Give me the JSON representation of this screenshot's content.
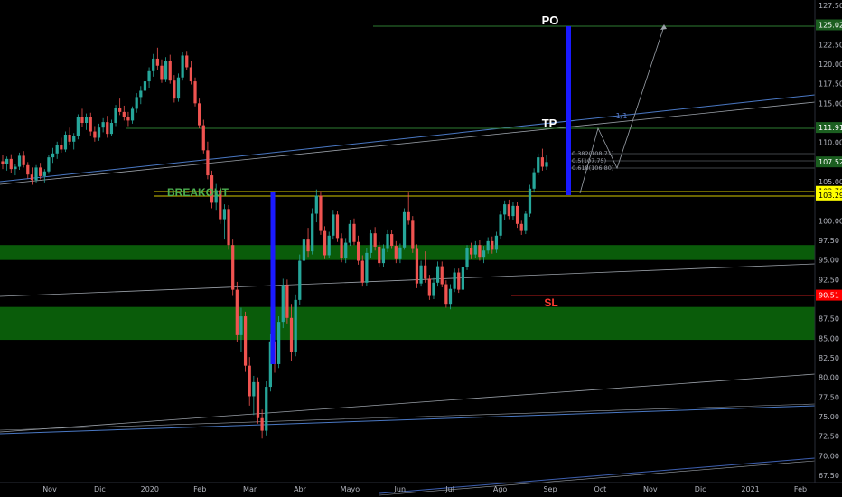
{
  "chart_data": {
    "type": "candlestick",
    "y_scale": "linear",
    "ylim": [
      67.5,
      127.5
    ],
    "y_ticks": [
      "127.50",
      "122.50",
      "120.00",
      "117.50",
      "115.00",
      "110.00",
      "105.00",
      "100.00",
      "97.50",
      "95.00",
      "92.50",
      "87.50",
      "85.00",
      "82.50",
      "80.00",
      "77.50",
      "75.00",
      "72.50",
      "70.00",
      "67.50"
    ],
    "x_ticks": [
      "Nov",
      "Dic",
      "2020",
      "Feb",
      "Mar",
      "Abr",
      "Mayo",
      "Jun",
      "Jul",
      "Ago",
      "Sep",
      "Oct",
      "Nov",
      "Dic",
      "2021",
      "Feb"
    ],
    "price_badges": [
      {
        "label": "125.02",
        "value": 125.02,
        "bg": "#1b5e20",
        "fg": "#ffffff"
      },
      {
        "label": "111.91",
        "value": 111.91,
        "bg": "#1b5e20",
        "fg": "#ffffff"
      },
      {
        "label": "107.52",
        "value": 107.52,
        "bg": "#1b5e20",
        "fg": "#ffffff"
      },
      {
        "label": "103.76",
        "value": 103.76,
        "bg": "#ffff00",
        "fg": "#000000"
      },
      {
        "label": "103.29",
        "value": 103.29,
        "bg": "#ffff00",
        "fg": "#000000"
      },
      {
        "label": "90.51",
        "value": 90.51,
        "bg": "#ff0000",
        "fg": "#ffffff"
      }
    ],
    "annotations": [
      {
        "text": "PO",
        "value": 125.5,
        "color": "#ffffff"
      },
      {
        "text": "TP",
        "value": 112.2,
        "color": "#ffffff"
      },
      {
        "text": "BREAKOUT",
        "value": 103.8,
        "color": "#4caf50"
      },
      {
        "text": "SL",
        "value": 89.8,
        "color": "#ff3b30"
      },
      {
        "text": "1/1",
        "value": 113.5,
        "color": "#5b7fd1"
      }
    ],
    "fib_levels": [
      {
        "label": "0.382(108.71)",
        "value": 108.71
      },
      {
        "label": "0.5(107.75)",
        "value": 107.75
      },
      {
        "label": "0.618(106.80)",
        "value": 106.8
      }
    ],
    "zones": [
      {
        "from": 95.0,
        "to": 96.9,
        "color": "#0a5c0a"
      },
      {
        "from": 84.8,
        "to": 89.0,
        "color": "#0a5c0a"
      }
    ],
    "candles": [
      {
        "o": 107.6,
        "h": 108.4,
        "l": 106.6,
        "c": 107.2
      },
      {
        "o": 107.2,
        "h": 108.2,
        "l": 106.4,
        "c": 107.9
      },
      {
        "o": 107.9,
        "h": 108.5,
        "l": 106.1,
        "c": 106.6
      },
      {
        "o": 106.6,
        "h": 107.3,
        "l": 105.8,
        "c": 106.9
      },
      {
        "o": 106.9,
        "h": 108.7,
        "l": 106.5,
        "c": 108.3
      },
      {
        "o": 108.3,
        "h": 108.9,
        "l": 106.8,
        "c": 107.1
      },
      {
        "o": 107.1,
        "h": 107.5,
        "l": 105.4,
        "c": 105.9
      },
      {
        "o": 105.9,
        "h": 106.8,
        "l": 104.6,
        "c": 105.2
      },
      {
        "o": 105.2,
        "h": 107.1,
        "l": 104.9,
        "c": 106.8
      },
      {
        "o": 106.8,
        "h": 107.4,
        "l": 105.3,
        "c": 105.7
      },
      {
        "o": 105.7,
        "h": 106.6,
        "l": 104.9,
        "c": 106.3
      },
      {
        "o": 106.3,
        "h": 108.4,
        "l": 106.0,
        "c": 108.1
      },
      {
        "o": 108.1,
        "h": 109.3,
        "l": 107.4,
        "c": 108.6
      },
      {
        "o": 108.6,
        "h": 110.1,
        "l": 107.9,
        "c": 109.7
      },
      {
        "o": 109.7,
        "h": 110.6,
        "l": 108.7,
        "c": 109.1
      },
      {
        "o": 109.1,
        "h": 111.4,
        "l": 108.8,
        "c": 111.0
      },
      {
        "o": 111.0,
        "h": 111.9,
        "l": 109.7,
        "c": 110.1
      },
      {
        "o": 110.1,
        "h": 111.2,
        "l": 109.1,
        "c": 110.8
      },
      {
        "o": 110.8,
        "h": 113.6,
        "l": 110.4,
        "c": 113.2
      },
      {
        "o": 113.2,
        "h": 114.3,
        "l": 112.0,
        "c": 112.5
      },
      {
        "o": 112.5,
        "h": 113.7,
        "l": 111.6,
        "c": 113.3
      },
      {
        "o": 113.3,
        "h": 113.8,
        "l": 110.9,
        "c": 111.4
      },
      {
        "o": 111.4,
        "h": 112.1,
        "l": 110.1,
        "c": 110.6
      },
      {
        "o": 110.6,
        "h": 112.4,
        "l": 110.2,
        "c": 111.9
      },
      {
        "o": 111.9,
        "h": 113.1,
        "l": 111.3,
        "c": 112.6
      },
      {
        "o": 112.6,
        "h": 113.4,
        "l": 110.6,
        "c": 111.1
      },
      {
        "o": 111.1,
        "h": 112.9,
        "l": 110.8,
        "c": 112.5
      },
      {
        "o": 112.5,
        "h": 114.8,
        "l": 112.1,
        "c": 114.4
      },
      {
        "o": 114.4,
        "h": 115.6,
        "l": 113.5,
        "c": 113.9
      },
      {
        "o": 113.9,
        "h": 114.7,
        "l": 112.8,
        "c": 113.2
      },
      {
        "o": 113.2,
        "h": 113.9,
        "l": 112.1,
        "c": 112.8
      },
      {
        "o": 112.8,
        "h": 114.6,
        "l": 112.4,
        "c": 114.3
      },
      {
        "o": 114.3,
        "h": 116.3,
        "l": 113.8,
        "c": 115.8
      },
      {
        "o": 115.8,
        "h": 117.2,
        "l": 114.9,
        "c": 116.6
      },
      {
        "o": 116.6,
        "h": 118.4,
        "l": 115.9,
        "c": 117.8
      },
      {
        "o": 117.8,
        "h": 119.6,
        "l": 117.0,
        "c": 119.1
      },
      {
        "o": 119.1,
        "h": 121.3,
        "l": 118.4,
        "c": 120.7
      },
      {
        "o": 120.7,
        "h": 122.1,
        "l": 119.3,
        "c": 119.8
      },
      {
        "o": 119.8,
        "h": 120.6,
        "l": 117.6,
        "c": 118.1
      },
      {
        "o": 118.1,
        "h": 120.9,
        "l": 117.7,
        "c": 120.4
      },
      {
        "o": 120.4,
        "h": 121.2,
        "l": 117.5,
        "c": 117.9
      },
      {
        "o": 117.9,
        "h": 118.6,
        "l": 115.1,
        "c": 115.6
      },
      {
        "o": 115.6,
        "h": 118.8,
        "l": 115.2,
        "c": 118.3
      },
      {
        "o": 118.3,
        "h": 121.6,
        "l": 117.9,
        "c": 121.1
      },
      {
        "o": 121.1,
        "h": 121.7,
        "l": 119.2,
        "c": 119.6
      },
      {
        "o": 119.6,
        "h": 120.4,
        "l": 117.4,
        "c": 117.8
      },
      {
        "o": 117.8,
        "h": 118.3,
        "l": 114.6,
        "c": 115.0
      },
      {
        "o": 115.0,
        "h": 115.6,
        "l": 111.8,
        "c": 112.2
      },
      {
        "o": 112.2,
        "h": 112.9,
        "l": 108.6,
        "c": 109.0
      },
      {
        "o": 109.0,
        "h": 110.1,
        "l": 105.3,
        "c": 105.8
      },
      {
        "o": 105.8,
        "h": 106.4,
        "l": 101.6,
        "c": 102.3
      },
      {
        "o": 102.3,
        "h": 104.7,
        "l": 101.4,
        "c": 103.9
      },
      {
        "o": 103.9,
        "h": 104.3,
        "l": 99.6,
        "c": 100.2
      },
      {
        "o": 100.2,
        "h": 102.1,
        "l": 97.6,
        "c": 101.5
      },
      {
        "o": 101.5,
        "h": 102.0,
        "l": 96.3,
        "c": 96.9
      },
      {
        "o": 96.9,
        "h": 97.6,
        "l": 90.4,
        "c": 91.2
      },
      {
        "o": 91.2,
        "h": 92.2,
        "l": 84.5,
        "c": 85.4
      },
      {
        "o": 85.4,
        "h": 88.9,
        "l": 83.2,
        "c": 87.8
      },
      {
        "o": 87.8,
        "h": 88.4,
        "l": 80.7,
        "c": 81.5
      },
      {
        "o": 81.5,
        "h": 82.6,
        "l": 76.4,
        "c": 77.6
      },
      {
        "o": 77.6,
        "h": 80.2,
        "l": 75.2,
        "c": 79.4
      },
      {
        "o": 79.4,
        "h": 80.0,
        "l": 74.1,
        "c": 74.8
      },
      {
        "o": 74.8,
        "h": 75.9,
        "l": 72.2,
        "c": 73.2
      },
      {
        "o": 73.2,
        "h": 79.5,
        "l": 72.6,
        "c": 78.8
      },
      {
        "o": 78.8,
        "h": 85.5,
        "l": 78.2,
        "c": 84.6
      },
      {
        "o": 84.6,
        "h": 86.2,
        "l": 80.6,
        "c": 81.7
      },
      {
        "o": 81.7,
        "h": 87.8,
        "l": 81.2,
        "c": 87.1
      },
      {
        "o": 87.1,
        "h": 92.6,
        "l": 86.3,
        "c": 91.8
      },
      {
        "o": 91.8,
        "h": 92.5,
        "l": 86.9,
        "c": 87.6
      },
      {
        "o": 87.6,
        "h": 89.4,
        "l": 82.1,
        "c": 83.2
      },
      {
        "o": 83.2,
        "h": 90.6,
        "l": 82.7,
        "c": 89.9
      },
      {
        "o": 89.9,
        "h": 95.7,
        "l": 89.2,
        "c": 94.9
      },
      {
        "o": 94.9,
        "h": 98.4,
        "l": 94.2,
        "c": 97.6
      },
      {
        "o": 97.6,
        "h": 99.1,
        "l": 95.4,
        "c": 96.1
      },
      {
        "o": 96.1,
        "h": 101.6,
        "l": 95.7,
        "c": 100.9
      },
      {
        "o": 100.9,
        "h": 104.0,
        "l": 99.8,
        "c": 103.2
      },
      {
        "o": 103.2,
        "h": 103.8,
        "l": 98.2,
        "c": 98.7
      },
      {
        "o": 98.7,
        "h": 99.3,
        "l": 95.1,
        "c": 95.6
      },
      {
        "o": 95.6,
        "h": 98.6,
        "l": 95.2,
        "c": 98.1
      },
      {
        "o": 98.1,
        "h": 101.4,
        "l": 97.6,
        "c": 100.8
      },
      {
        "o": 100.8,
        "h": 101.2,
        "l": 97.3,
        "c": 97.8
      },
      {
        "o": 97.8,
        "h": 98.4,
        "l": 94.7,
        "c": 95.2
      },
      {
        "o": 95.2,
        "h": 97.8,
        "l": 94.6,
        "c": 97.2
      },
      {
        "o": 97.2,
        "h": 100.1,
        "l": 96.8,
        "c": 99.6
      },
      {
        "o": 99.6,
        "h": 100.3,
        "l": 96.9,
        "c": 97.3
      },
      {
        "o": 97.3,
        "h": 98.1,
        "l": 94.4,
        "c": 94.9
      },
      {
        "o": 94.9,
        "h": 95.6,
        "l": 91.6,
        "c": 92.1
      },
      {
        "o": 92.1,
        "h": 96.5,
        "l": 91.7,
        "c": 95.9
      },
      {
        "o": 95.9,
        "h": 98.9,
        "l": 95.3,
        "c": 98.4
      },
      {
        "o": 98.4,
        "h": 99.2,
        "l": 96.2,
        "c": 96.7
      },
      {
        "o": 96.7,
        "h": 97.3,
        "l": 94.1,
        "c": 94.6
      },
      {
        "o": 94.6,
        "h": 97.0,
        "l": 94.1,
        "c": 96.4
      },
      {
        "o": 96.4,
        "h": 98.9,
        "l": 96.0,
        "c": 98.3
      },
      {
        "o": 98.3,
        "h": 98.8,
        "l": 96.4,
        "c": 96.8
      },
      {
        "o": 96.8,
        "h": 97.4,
        "l": 94.6,
        "c": 95.1
      },
      {
        "o": 95.1,
        "h": 97.1,
        "l": 94.6,
        "c": 96.6
      },
      {
        "o": 96.6,
        "h": 101.6,
        "l": 96.3,
        "c": 101.1
      },
      {
        "o": 101.1,
        "h": 103.6,
        "l": 99.5,
        "c": 100.0
      },
      {
        "o": 100.0,
        "h": 100.6,
        "l": 95.9,
        "c": 96.4
      },
      {
        "o": 96.4,
        "h": 97.0,
        "l": 91.4,
        "c": 92.0
      },
      {
        "o": 92.0,
        "h": 94.9,
        "l": 91.6,
        "c": 94.3
      },
      {
        "o": 94.3,
        "h": 96.1,
        "l": 92.1,
        "c": 92.6
      },
      {
        "o": 92.6,
        "h": 93.1,
        "l": 89.9,
        "c": 90.4
      },
      {
        "o": 90.4,
        "h": 92.7,
        "l": 90.0,
        "c": 92.1
      },
      {
        "o": 92.1,
        "h": 94.8,
        "l": 91.6,
        "c": 94.2
      },
      {
        "o": 94.2,
        "h": 94.8,
        "l": 91.5,
        "c": 91.9
      },
      {
        "o": 91.9,
        "h": 92.4,
        "l": 88.9,
        "c": 89.4
      },
      {
        "o": 89.4,
        "h": 91.9,
        "l": 88.7,
        "c": 91.3
      },
      {
        "o": 91.3,
        "h": 93.9,
        "l": 90.9,
        "c": 93.4
      },
      {
        "o": 93.4,
        "h": 93.9,
        "l": 90.8,
        "c": 91.2
      },
      {
        "o": 91.2,
        "h": 94.6,
        "l": 90.8,
        "c": 94.1
      },
      {
        "o": 94.1,
        "h": 96.9,
        "l": 93.7,
        "c": 96.5
      },
      {
        "o": 96.5,
        "h": 97.2,
        "l": 95.1,
        "c": 95.7
      },
      {
        "o": 95.7,
        "h": 97.4,
        "l": 95.3,
        "c": 96.9
      },
      {
        "o": 96.9,
        "h": 97.5,
        "l": 94.9,
        "c": 95.4
      },
      {
        "o": 95.4,
        "h": 96.8,
        "l": 94.6,
        "c": 96.2
      },
      {
        "o": 96.2,
        "h": 97.9,
        "l": 95.8,
        "c": 97.4
      },
      {
        "o": 97.4,
        "h": 98.0,
        "l": 95.8,
        "c": 96.3
      },
      {
        "o": 96.3,
        "h": 98.6,
        "l": 95.9,
        "c": 98.1
      },
      {
        "o": 98.1,
        "h": 101.3,
        "l": 97.7,
        "c": 100.8
      },
      {
        "o": 100.8,
        "h": 102.6,
        "l": 100.1,
        "c": 102.1
      },
      {
        "o": 102.1,
        "h": 102.7,
        "l": 100.2,
        "c": 100.6
      },
      {
        "o": 100.6,
        "h": 102.4,
        "l": 100.1,
        "c": 101.9
      },
      {
        "o": 101.9,
        "h": 102.4,
        "l": 99.1,
        "c": 99.6
      },
      {
        "o": 99.6,
        "h": 100.0,
        "l": 98.2,
        "c": 98.7
      },
      {
        "o": 98.7,
        "h": 101.2,
        "l": 98.3,
        "c": 100.9
      },
      {
        "o": 100.9,
        "h": 104.6,
        "l": 100.5,
        "c": 104.1
      },
      {
        "o": 104.1,
        "h": 106.7,
        "l": 103.6,
        "c": 106.2
      },
      {
        "o": 106.2,
        "h": 108.6,
        "l": 105.8,
        "c": 108.1
      },
      {
        "o": 108.1,
        "h": 109.2,
        "l": 106.4,
        "c": 106.9
      },
      {
        "o": 106.9,
        "h": 108.4,
        "l": 106.5,
        "c": 107.5
      }
    ]
  }
}
